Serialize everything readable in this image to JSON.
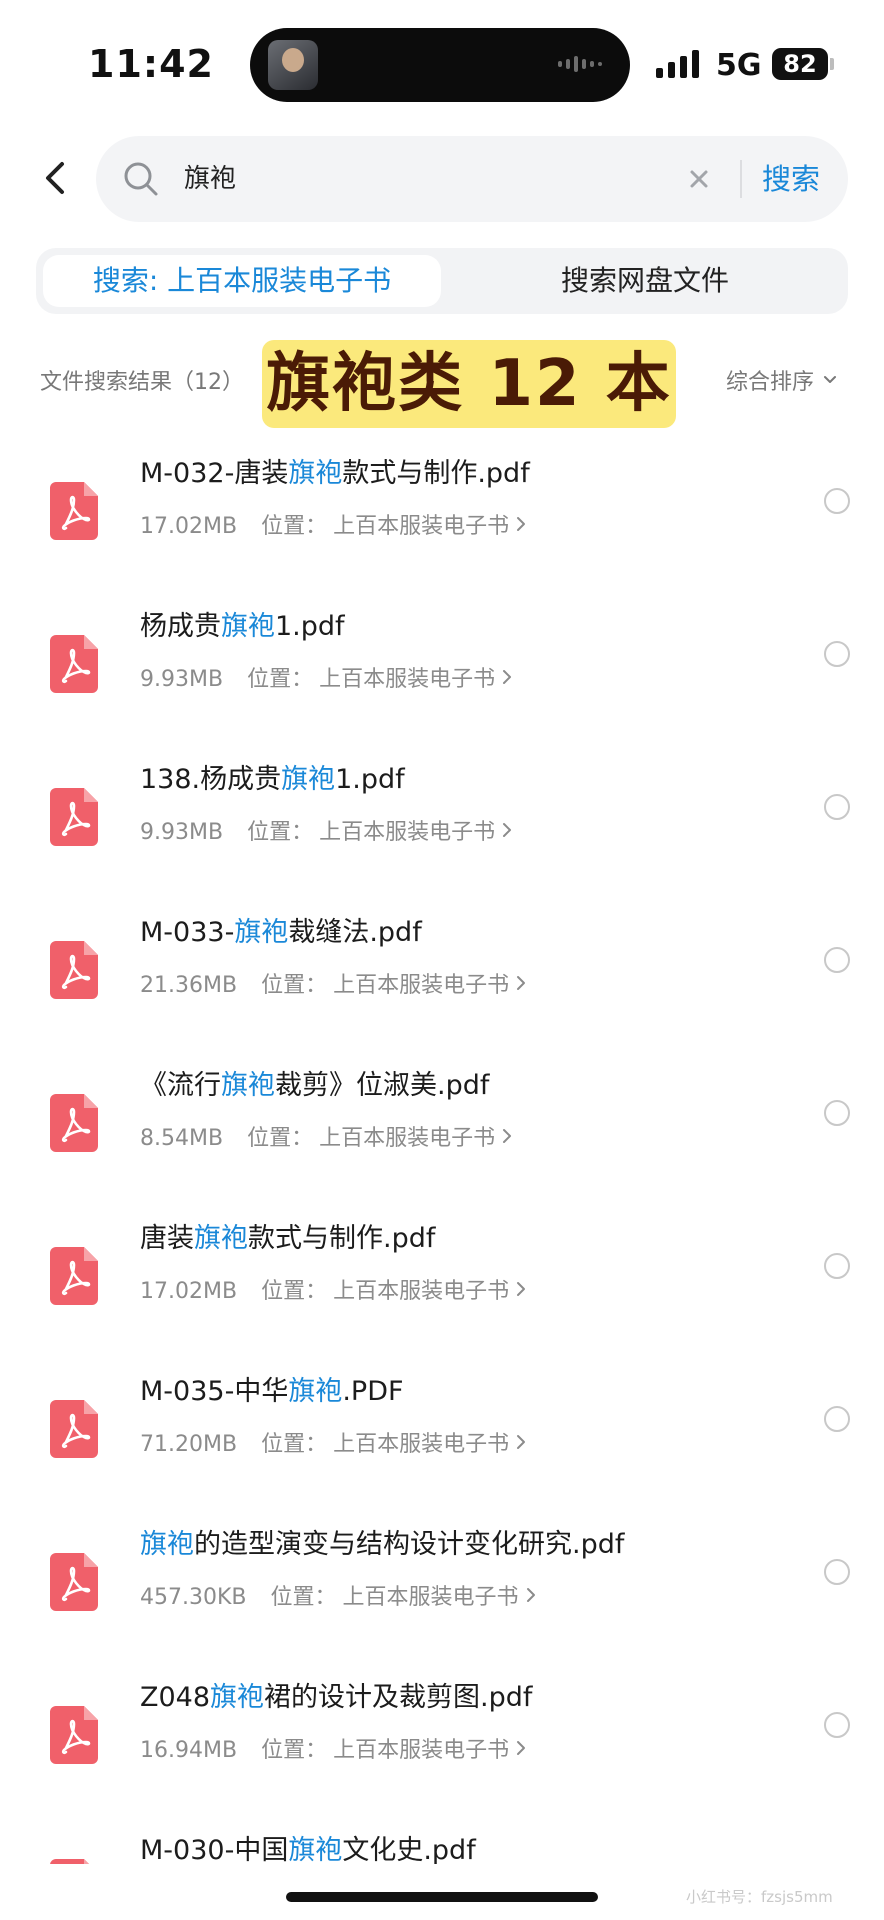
{
  "status_bar": {
    "time": "11:42",
    "network": "5G",
    "battery": "82"
  },
  "search": {
    "query": "旗袍",
    "button_label": "搜索"
  },
  "tabs": [
    {
      "label": "搜索: 上百本服装电子书",
      "active": true
    },
    {
      "label": "搜索网盘文件",
      "active": false
    }
  ],
  "results": {
    "header": "文件搜索结果（12）",
    "overlay_label": "旗袍类 12 本",
    "sort_label": "综合排序"
  },
  "location_prefix": "位置：",
  "colors": {
    "accent": "#1a88d8",
    "pdf_icon": "#f0606a",
    "badge_bg": "#fbe97c",
    "badge_text": "#4a1b06"
  },
  "files": [
    {
      "pre": "M-032-唐装",
      "hl": "旗袍",
      "post": "款式与制作.pdf",
      "size": "17.02MB",
      "location": "上百本服装电子书"
    },
    {
      "pre": "杨成贵",
      "hl": "旗袍",
      "post": "1.pdf",
      "size": "9.93MB",
      "location": "上百本服装电子书"
    },
    {
      "pre": "138.杨成贵",
      "hl": "旗袍",
      "post": "1.pdf",
      "size": "9.93MB",
      "location": "上百本服装电子书"
    },
    {
      "pre": "M-033-",
      "hl": "旗袍",
      "post": "裁缝法.pdf",
      "size": "21.36MB",
      "location": "上百本服装电子书"
    },
    {
      "pre": "《流行",
      "hl": "旗袍",
      "post": "裁剪》位淑美.pdf",
      "size": "8.54MB",
      "location": "上百本服装电子书"
    },
    {
      "pre": "唐装",
      "hl": "旗袍",
      "post": "款式与制作.pdf",
      "size": "17.02MB",
      "location": "上百本服装电子书"
    },
    {
      "pre": "M-035-中华",
      "hl": "旗袍",
      "post": ".PDF",
      "size": "71.20MB",
      "location": "上百本服装电子书"
    },
    {
      "pre": "",
      "hl": "旗袍",
      "post": "的造型演变与结构设计变化研究.pdf",
      "size": "457.30KB",
      "location": "上百本服装电子书"
    },
    {
      "pre": "Z048",
      "hl": "旗袍",
      "post": "裙的设计及裁剪图.pdf",
      "size": "16.94MB",
      "location": "上百本服装电子书"
    },
    {
      "pre": "M-030-中国",
      "hl": "旗袍",
      "post": "文化史.pdf",
      "size": "",
      "location": ""
    }
  ],
  "watermark": "小红书号：fzsjs5mm"
}
